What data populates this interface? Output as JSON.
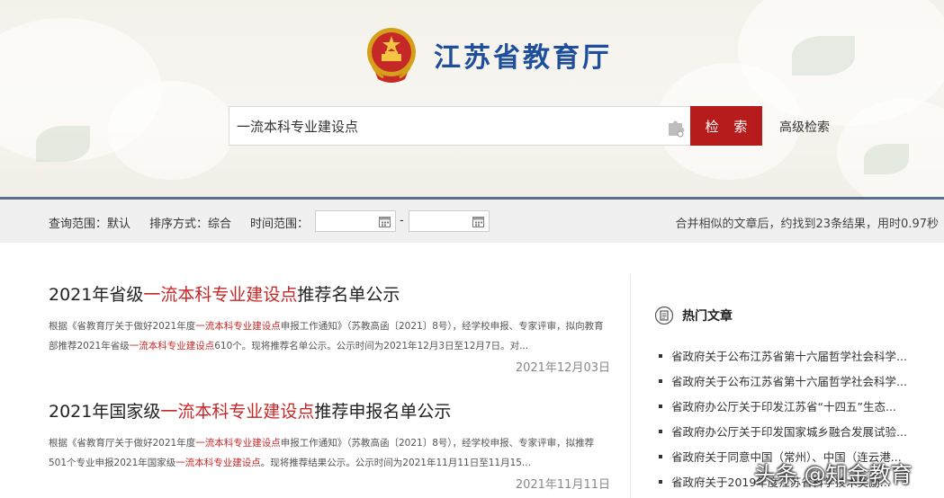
{
  "header": {
    "site_title": "江苏省教育厅",
    "search_value": "一流本科专业建设点",
    "search_button": "检 索",
    "advanced_search": "高级检索"
  },
  "filter": {
    "scope": "查询范围：默认",
    "sort": "排序方式：综合",
    "time_label": "时间范围：",
    "date_from": "",
    "date_to": "",
    "separator": "-",
    "result_summary": "合并相似的文章后，约找到23条结果，用时0.97秒"
  },
  "results": [
    {
      "title_pre": "2021年省级",
      "title_hl": "一流本科专业建设点",
      "title_post": "推荐名单公示",
      "s1": "根据《省教育厅关于做好2021年度",
      "s1_hl": "一流本科专业建设点",
      "s2": "申报工作通知》（苏教高函〔2021〕8号），经学校申报、专家评审，拟向教育部推荐2021年省级",
      "s2_hl": "一流本科专业建设点",
      "s3": "610个。现将推荐名单公示。公示时间为2021年12月3日至12月7日。对...",
      "date": "2021年12月03日"
    },
    {
      "title_pre": "2021年国家级",
      "title_hl": "一流本科专业建设点",
      "title_post": "推荐申报名单公示",
      "s1": "根据《省教育厅关于做好2021年度",
      "s1_hl": "一流本科专业建设点",
      "s2": "申报工作通知》（苏教高函〔2021〕8号），经学校申报、专家评审，拟推荐501个专业申报2021年国家级",
      "s2_hl": "一流本科专业建设点",
      "s3": "。现将推荐结果公示。公示时间为2021年11月11日至11月15...",
      "date": "2021年11月11日"
    }
  ],
  "hot": {
    "title": "热门文章",
    "items": [
      "省政府关于公布江苏省第十六届哲学社会科学...",
      "省政府关于公布江苏省第十六届哲学社会科学...",
      "省政府办公厅关于印发江苏省“十四五”生态...",
      "省政府办公厅关于印发国家城乡融合发展试验...",
      "省政府关于同意中国（常州）、中国（连云港...",
      "省政府关于2019年度江苏省科学技术奖励..."
    ]
  },
  "watermark": "头条 @知金教育",
  "colors": {
    "accent_red": "#b71c1c",
    "title_blue": "#1f4f9a",
    "highlight": "#c62828"
  }
}
